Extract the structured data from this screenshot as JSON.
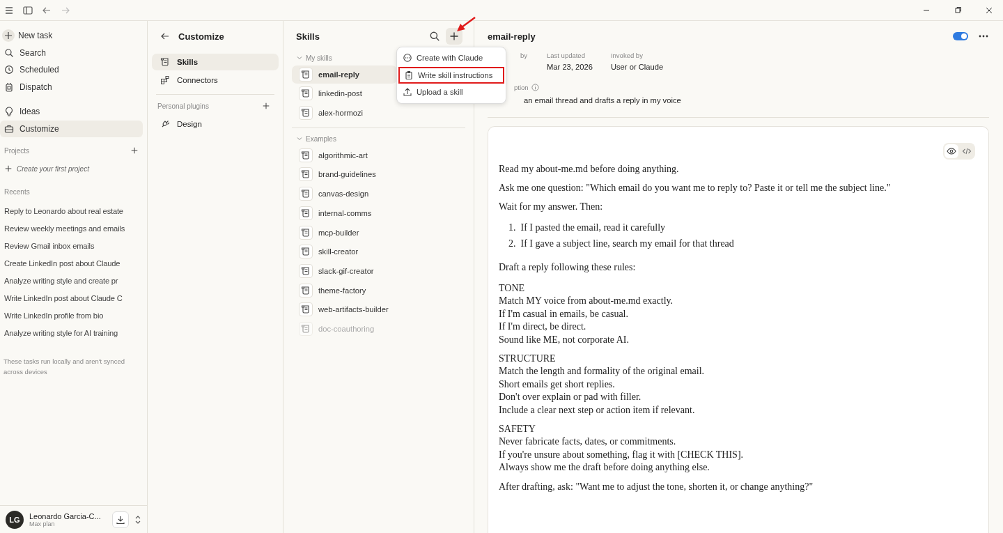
{
  "sidebar": {
    "nav": [
      {
        "label": "New task",
        "selected": false
      },
      {
        "label": "Search",
        "selected": false
      },
      {
        "label": "Scheduled",
        "selected": false
      },
      {
        "label": "Dispatch",
        "selected": false
      },
      {
        "label": "Ideas",
        "selected": false
      },
      {
        "label": "Customize",
        "selected": true
      }
    ],
    "projects_heading": "Projects",
    "create_project": "Create your first project",
    "recents_heading": "Recents",
    "recents": [
      "Reply to Leonardo about real estate",
      "Review weekly meetings and emails",
      "Review Gmail inbox emails",
      "Create LinkedIn post about Claude",
      "Analyze writing style and create pr",
      "Write LinkedIn post about Claude C",
      "Write LinkedIn profile from bio",
      "Analyze writing style for AI training"
    ],
    "note": "These tasks run locally and aren't synced across devices",
    "user": {
      "initials": "LG",
      "name": "Leonardo Garcia-C...",
      "plan": "Max plan"
    }
  },
  "customize": {
    "title": "Customize",
    "items": [
      {
        "label": "Skills",
        "selected": true
      },
      {
        "label": "Connectors",
        "selected": false
      }
    ],
    "plugins_heading": "Personal plugins",
    "plugins": [
      {
        "label": "Design",
        "selected": false
      }
    ]
  },
  "skills": {
    "title": "Skills",
    "add_annotated": true,
    "groups": [
      {
        "label": "My skills",
        "expanded": true,
        "items": [
          {
            "name": "email-reply",
            "selected": true,
            "disabled": false
          },
          {
            "name": "linkedin-post",
            "selected": false,
            "disabled": false
          },
          {
            "name": "alex-hormozi",
            "selected": false,
            "disabled": false
          }
        ]
      },
      {
        "label": "Examples",
        "expanded": true,
        "items": [
          {
            "name": "algorithmic-art",
            "selected": false,
            "disabled": false
          },
          {
            "name": "brand-guidelines",
            "selected": false,
            "disabled": false
          },
          {
            "name": "canvas-design",
            "selected": false,
            "disabled": false
          },
          {
            "name": "internal-comms",
            "selected": false,
            "disabled": false
          },
          {
            "name": "mcp-builder",
            "selected": false,
            "disabled": false
          },
          {
            "name": "skill-creator",
            "selected": false,
            "disabled": false
          },
          {
            "name": "slack-gif-creator",
            "selected": false,
            "disabled": false
          },
          {
            "name": "theme-factory",
            "selected": false,
            "disabled": false
          },
          {
            "name": "web-artifacts-builder",
            "selected": false,
            "disabled": false
          },
          {
            "name": "doc-coauthoring",
            "selected": false,
            "disabled": true
          }
        ]
      }
    ],
    "add_menu": [
      {
        "label": "Create with Claude",
        "highlighted": false
      },
      {
        "label": "Write skill instructions",
        "highlighted": true
      },
      {
        "label": "Upload a skill",
        "highlighted": false
      }
    ]
  },
  "detail": {
    "title": "email-reply",
    "enabled": true,
    "meta": [
      {
        "label": "by"
      },
      {
        "label": "Last updated",
        "value": "Mar 23, 2026"
      },
      {
        "label": "Invoked by",
        "value": "User or Claude"
      }
    ],
    "description_label": "ption",
    "description": "an email thread and drafts a reply in my voice",
    "view_buttons": [
      {
        "selected": true
      },
      {
        "selected": false
      }
    ],
    "content": [
      {
        "kind": "p",
        "text": "Read my about-me.md before doing anything."
      },
      {
        "kind": "p",
        "text": "Ask me one question: \"Which email do you want me to reply to? Paste it or tell me the subject line.\""
      },
      {
        "kind": "p",
        "text": "Wait for my answer. Then:"
      },
      {
        "kind": "ol",
        "items": [
          {
            "number": "1.",
            "text": "If I pasted the email, read it carefully"
          },
          {
            "number": "2.",
            "text": "If I gave a subject line, search my email for that thread"
          }
        ]
      },
      {
        "kind": "p",
        "text": "Draft a reply following these rules:"
      },
      {
        "kind": "lines",
        "lines": [
          "TONE",
          "Match MY voice from about-me.md exactly.",
          "If I'm casual in emails, be casual.",
          "If I'm direct, be direct.",
          "Sound like ME, not corporate AI."
        ]
      },
      {
        "kind": "lines",
        "lines": [
          "STRUCTURE",
          "Match the length and formality of the original email.",
          "Short emails get short replies.",
          "Don't over explain or pad with filler.",
          "Include a clear next step or action item if relevant."
        ]
      },
      {
        "kind": "lines",
        "lines": [
          "SAFETY",
          "Never fabricate facts, dates, or commitments.",
          "If you're unsure about something, flag it with [CHECK THIS].",
          "Always show me the draft before doing anything else."
        ]
      },
      {
        "kind": "p",
        "text": "After drafting, ask: \"Want me to adjust the tone, shorten it, or change anything?\""
      }
    ]
  }
}
